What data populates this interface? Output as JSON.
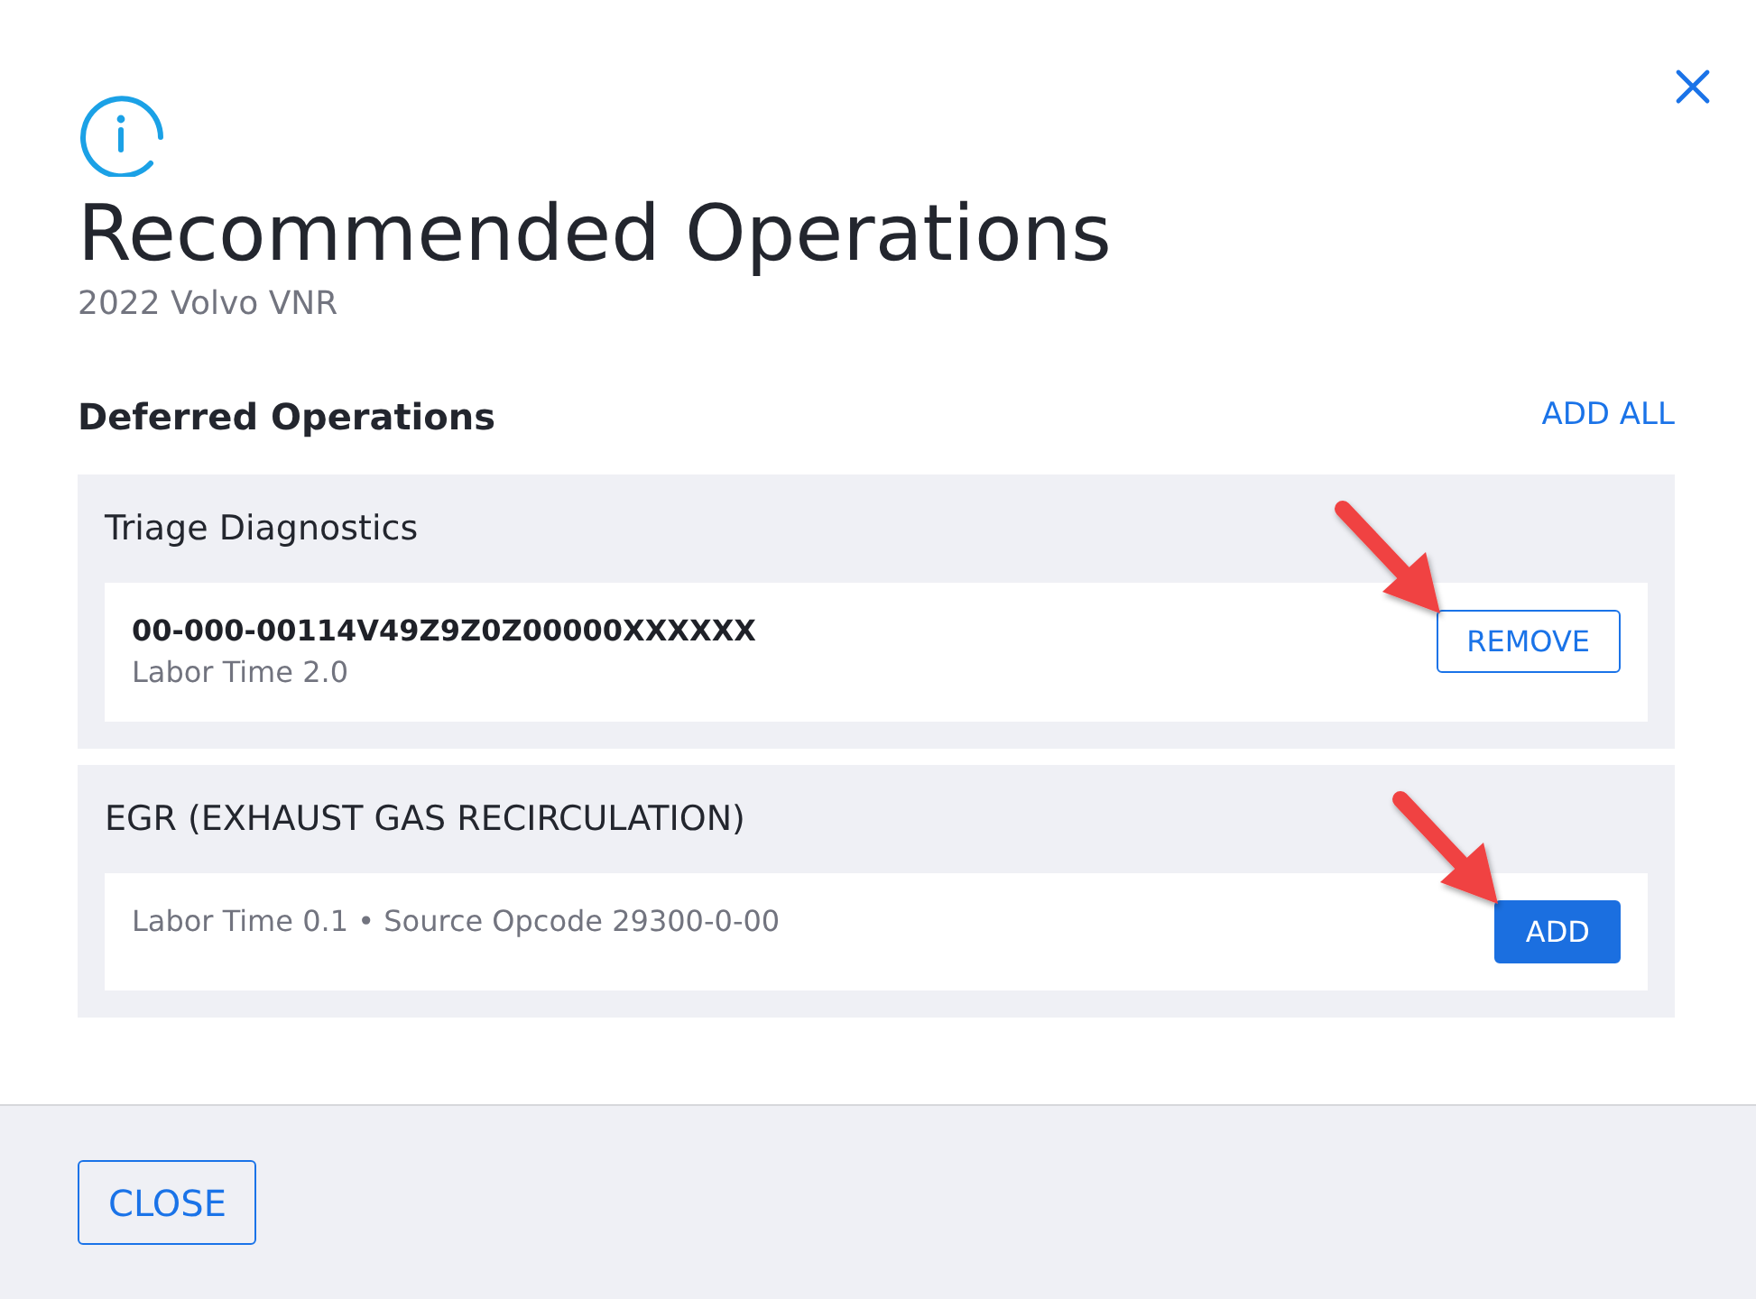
{
  "dialog": {
    "title": "Recommended Operations",
    "subtitle": "2022 Volvo VNR"
  },
  "section": {
    "heading": "Deferred Operations",
    "action": "ADD ALL"
  },
  "groups": [
    {
      "title": "Triage Diagnostics",
      "operations": [
        {
          "code": "00-000-00114V49Z9Z0Z00000XXXXXX",
          "details": "Labor Time 2.0",
          "action": {
            "kind": "remove",
            "label": "REMOVE"
          },
          "highlighted": true
        }
      ]
    },
    {
      "title": "EGR (EXHAUST GAS RECIRCULATION)",
      "operations": [
        {
          "details": "Labor Time 0.1 • Source Opcode 29300-0-00",
          "action": {
            "kind": "add",
            "label": "ADD"
          },
          "highlighted": true
        }
      ]
    }
  ],
  "footer": {
    "buttons": [
      "CLOSE"
    ]
  }
}
